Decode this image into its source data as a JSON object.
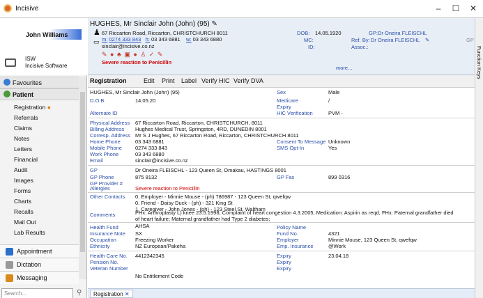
{
  "window": {
    "title": "Incisive",
    "min": "–",
    "max": "☐",
    "close": "✕"
  },
  "user": {
    "name": "John Williams",
    "org_line1": "ISW",
    "org_line2": "Incisive Software"
  },
  "nav": {
    "favourites": "Favourites",
    "patient": "Patient",
    "sub": [
      "Registration",
      "Referrals",
      "Claims",
      "Notes",
      "Letters",
      "Financial",
      "Audit",
      "Images",
      "Forms",
      "Charts",
      "Recalls",
      "Mail Out",
      "Lab Results"
    ],
    "bottom": [
      "Appointment",
      "Dictation",
      "Messaging"
    ],
    "search_placeholder": "Search..."
  },
  "header": {
    "patient_name": "HUGHES, Mr Sinclair John (John) (95)",
    "address": "67 Riccarton Road, Riccarton, CHRISTCHURCH 8011",
    "mobile_label": "m:",
    "mobile": "0274 333 843",
    "home_label": "h:",
    "home": "03 343 6881",
    "work_label": "w:",
    "work": "03 343 6880",
    "email": "sinclair@incisive.co.nz",
    "alert": "Severe reaction to Penicillin",
    "dob_label": "DOB:",
    "dob": "14.05.1920",
    "mc_label": "MC:",
    "id_label": "ID:",
    "gp_label": "GP:",
    "gp": "Dr Oneira FLEISCHL",
    "refby_label": "Ref. By:",
    "refby": "Dr Oneira FLEISCHL",
    "assoc_label": "Assoc.:",
    "more": "more...",
    "gp_short": "GP"
  },
  "toolbar": {
    "title": "Registration",
    "edit": "Edit",
    "print": "Print",
    "label": "Label",
    "verify_hic": "Verify HIC",
    "verify_dva": "Verify DVA"
  },
  "details": {
    "name": "HUGHES, Mr Sinclair John (John) (95)",
    "sex_label": "Sex",
    "sex": "Male",
    "dob_label": "D.O.B.",
    "dob": "14.05.20",
    "medicare_label": "Medicare",
    "medicare": "/",
    "expiry_label": "Expiry",
    "altid_label": "Alternate ID",
    "hic_label": "HIC Verification",
    "hic": "PVM -",
    "phys_label": "Physical Address",
    "phys": "67 Riccarton Road, Riccarton, CHRISTCHURCH,  8011",
    "bill_label": "Billing Address",
    "bill": "Hughes Medical Trust, Springston, 4RD, DUNEDIN  8001",
    "corr_label": "Corresp. Address",
    "corr": "Mr S J Hughes, 67 Riccarton Road, Riccarton, CHRISTCHURCH  8011",
    "homep_label": "Home Phone",
    "homep": "03 343 6881",
    "consent_label": "Consent To Message",
    "consent": "Unknown",
    "mobp_label": "Mobile Phone",
    "mobp": "0274 333 843",
    "sms_label": "SMS Opt-In",
    "sms": "Yes",
    "workp_label": "Work Phone",
    "workp": "03 343 6880",
    "email_label": "Email",
    "email": "sinclair@incisive.co.nz",
    "gp_label": "GP",
    "gp": "Dr Oneira FLEISCHL - 123 Queen St, Omakau, HASTINGS 8001",
    "gpphone_label": "GP Phone",
    "gpphone": "875 8132",
    "gpfax_label": "GP Fax",
    "gpfax": "899 0316",
    "gpprov_label": "GP Provider #",
    "allergies_label": "Allergies",
    "allergies": "Severe reaction to Penicillin",
    "contacts_label": "Other Contacts",
    "contacts": [
      "0. Employer - Minnie Mouse - (ph) 786987 - 123 Queen St, qwefqw",
      "0. Friend - Daisy Duck - (ph)  - 321 King St",
      "1. Caregiver - John Jones - (ph)  - 123 Steel St, Waltham"
    ],
    "comments_label": "Comments",
    "comments1": "PHx: Arthroplasty L) knee 23.5.1998; Complaint of heart congestion 4.3.2005, Medication: Aspirin as reqd, FHx: Paternal grandfather died",
    "comments2": "of heart failure; Maternal grandfather had Type 2 diabetes;",
    "hf_label": "Health Fund",
    "hf": "AHSA",
    "policy_label": "Policy Name",
    "insnote_label": "Insurance Note",
    "insnote": "SX",
    "fundno_label": "Fund No.",
    "fundno": "4321",
    "occ_label": "Occupation",
    "occ": "Freezing Worker",
    "employer_label": "Employer",
    "employer": "Minnie Mouse, 123 Queen St, qwefqw",
    "eth_label": "Ethnicity",
    "eth": "NZ European/Pakeha",
    "empins_label": "Emp. Insurance",
    "empins": "@Work",
    "hcn_label": "Health Care No.",
    "hcn": "4412342345",
    "hcexp": "23.04.18",
    "pension_label": "Pension No.",
    "veteran_label": "Veteran Number",
    "entitlement": "No Entitlement Code"
  },
  "side_panel": {
    "label": "Function Keys"
  },
  "tabs": [
    {
      "label": "Registration"
    }
  ]
}
